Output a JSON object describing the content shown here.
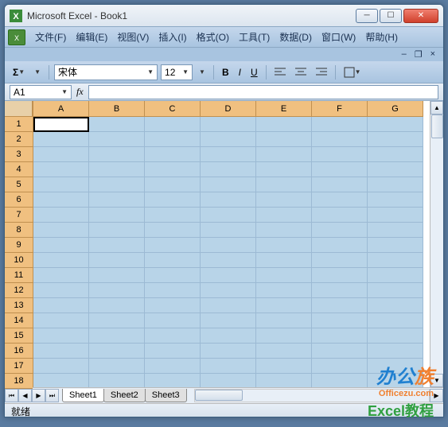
{
  "title": "Microsoft Excel - Book1",
  "menus": [
    "文件(F)",
    "编辑(E)",
    "视图(V)",
    "插入(I)",
    "格式(O)",
    "工具(T)",
    "数据(D)",
    "窗口(W)",
    "帮助(H)"
  ],
  "font": {
    "name": "宋体",
    "size": "12"
  },
  "namebox": "A1",
  "columns": [
    "A",
    "B",
    "C",
    "D",
    "E",
    "F",
    "G"
  ],
  "rows": [
    "1",
    "2",
    "3",
    "4",
    "5",
    "6",
    "7",
    "8",
    "9",
    "10",
    "11",
    "12",
    "13",
    "14",
    "15",
    "16",
    "17",
    "18"
  ],
  "sheets": [
    "Sheet1",
    "Sheet2",
    "Sheet3"
  ],
  "status": "就绪",
  "watermark": {
    "brand_left": "办公",
    "brand_right": "族",
    "url": "Officezu.com",
    "tut": "Excel教程"
  }
}
